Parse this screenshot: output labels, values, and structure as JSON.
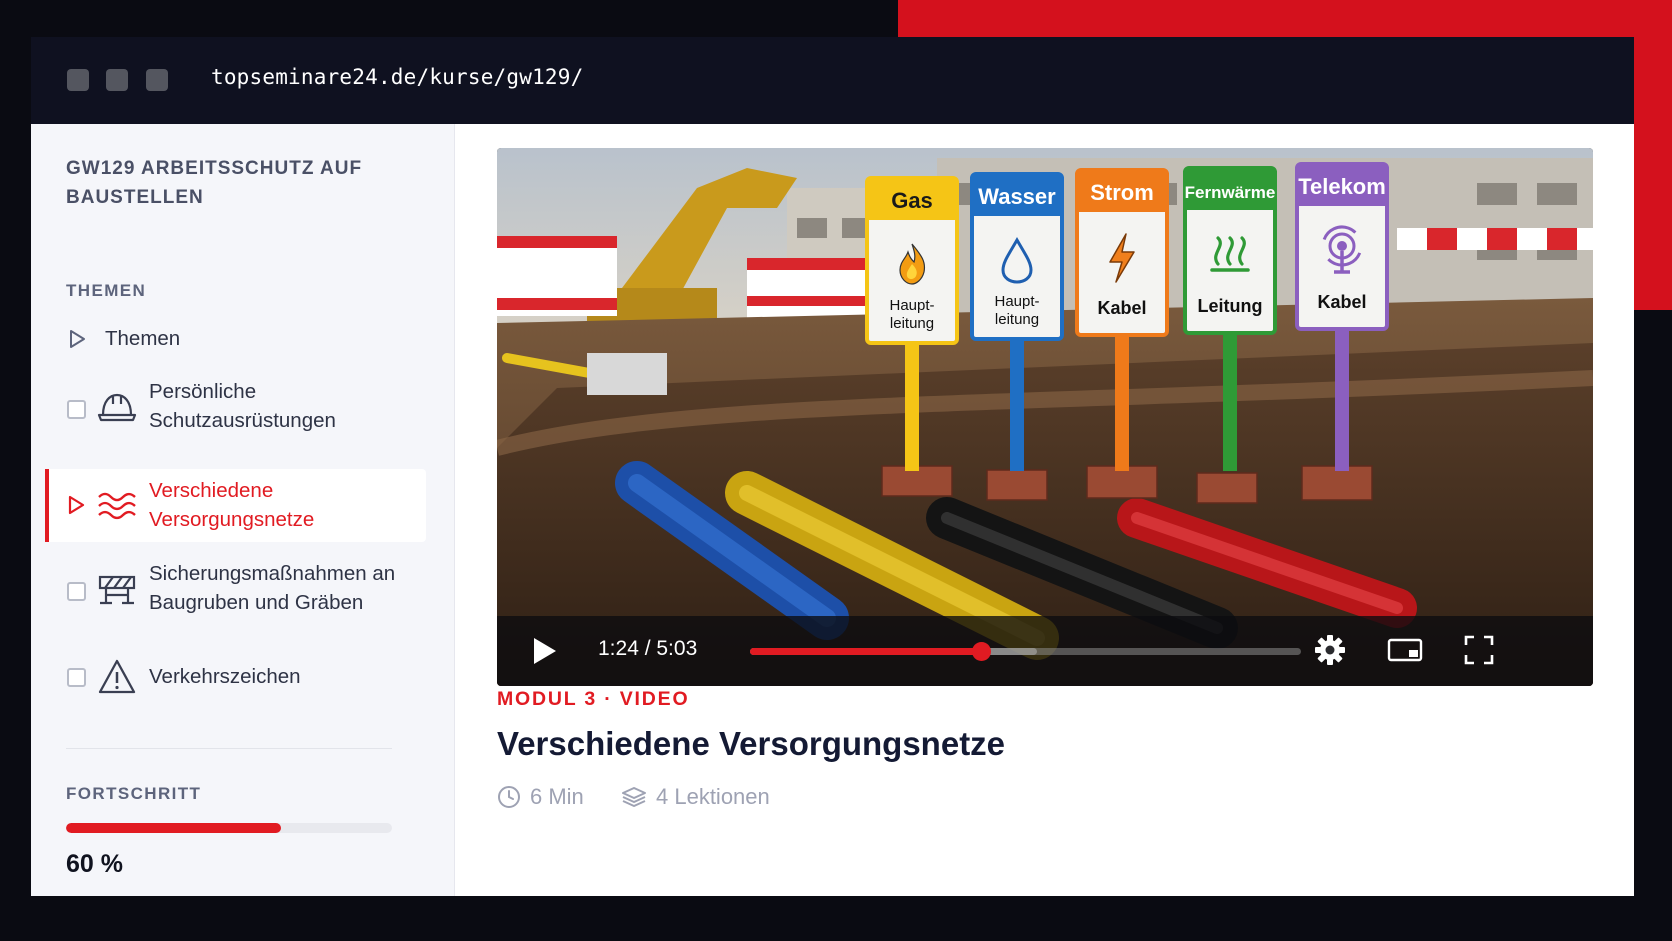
{
  "browser": {
    "url": "topseminare24.de/kurse/gw129/"
  },
  "sidebar": {
    "course_title": "GW129 ARBEITSSCHUTZ AUF BAUSTELLEN",
    "section_label": "THEMEN",
    "items": [
      {
        "label": "Themen",
        "icon": "play-outline-icon",
        "state": "header"
      },
      {
        "label": "Persönliche Schutzausrüstungen",
        "icon": "hard-hat-icon",
        "state": "unchecked"
      },
      {
        "label": "Verschiedene Versorgungsnetze",
        "icon": "waves-icon",
        "state": "active"
      },
      {
        "label": "Sicherungsmaßnahmen an Baugruben und Gräben",
        "icon": "barrier-icon",
        "state": "unchecked"
      },
      {
        "label": "Verkehrszeichen",
        "icon": "warning-triangle-icon",
        "state": "unchecked"
      }
    ],
    "progress_label": "FORTSCHRITT",
    "progress_value": "60 %",
    "progress_fraction": 0.66
  },
  "video": {
    "current_time": "1:24",
    "duration": "5:03",
    "time_display": "1:24 / 5:03",
    "played_fraction": 0.42,
    "buffered_fraction": 0.52,
    "signs": [
      {
        "title": "Gas",
        "text": "Haupt-\nleitung",
        "color": "#f5c516",
        "icon": "flame-icon"
      },
      {
        "title": "Wasser",
        "text": "Haupt-\nleitung",
        "color": "#1f6fc4",
        "icon": "drop-icon"
      },
      {
        "title": "Strom",
        "text": "Kabel",
        "color": "#ef7a1a",
        "icon": "bolt-icon"
      },
      {
        "title": "Fernwärme",
        "text": "Leitung",
        "color": "#2f9a36",
        "icon": "heat-icon"
      },
      {
        "title": "Telekom",
        "text": "Kabel",
        "color": "#8b5fbf",
        "icon": "antenna-icon"
      }
    ]
  },
  "content": {
    "eyebrow": "MODUL 3 · VIDEO",
    "title": "Verschiedene Versorgungsnetze",
    "duration": "6 Min",
    "lessons": "4 Lektionen"
  },
  "colors": {
    "accent": "#e11b22",
    "titlebar": "#0f1120",
    "sidebar_bg": "#f5f6fa"
  }
}
